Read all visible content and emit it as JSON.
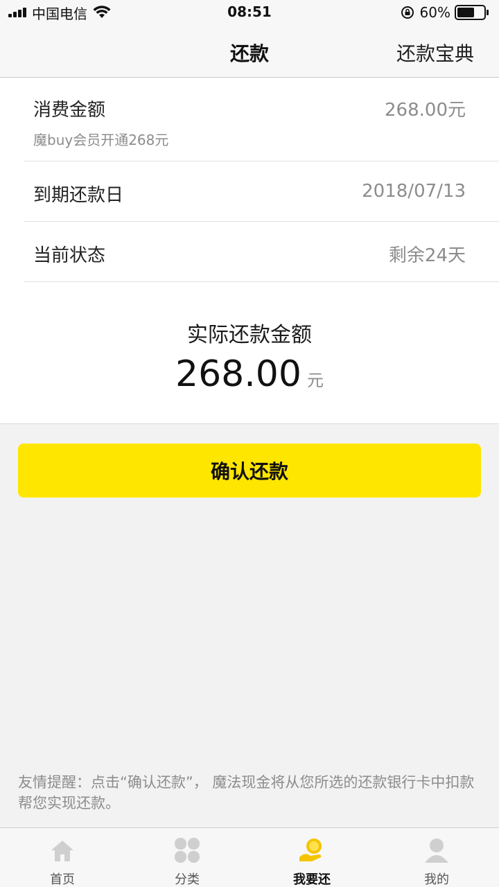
{
  "status_bar": {
    "carrier": "中国电信",
    "time": "08:51",
    "battery": "60%"
  },
  "nav": {
    "title": "还款",
    "right_link": "还款宝典"
  },
  "details": {
    "consumption": {
      "label": "消费金额",
      "value": "268.00元",
      "sub": "魔buy会员开通268元"
    },
    "due_date": {
      "label": "到期还款日",
      "value": "2018/07/13"
    },
    "status": {
      "label": "当前状态",
      "value": "剩余24天"
    }
  },
  "actual": {
    "label": "实际还款金额",
    "amount": "268.00",
    "unit": "元"
  },
  "confirm_label": "确认还款",
  "tip": "友情提醒：点击“确认还款”， 魔法现金将从您所选的还款银行卡中扣款帮您实现还款。",
  "tabs": [
    {
      "label": "首页",
      "icon": "home-icon"
    },
    {
      "label": "分类",
      "icon": "category-icon"
    },
    {
      "label": "我要还",
      "icon": "repay-icon",
      "active": true
    },
    {
      "label": "我的",
      "icon": "profile-icon"
    }
  ],
  "colors": {
    "accent": "#ffe600",
    "active_icon": "#f5c400"
  }
}
